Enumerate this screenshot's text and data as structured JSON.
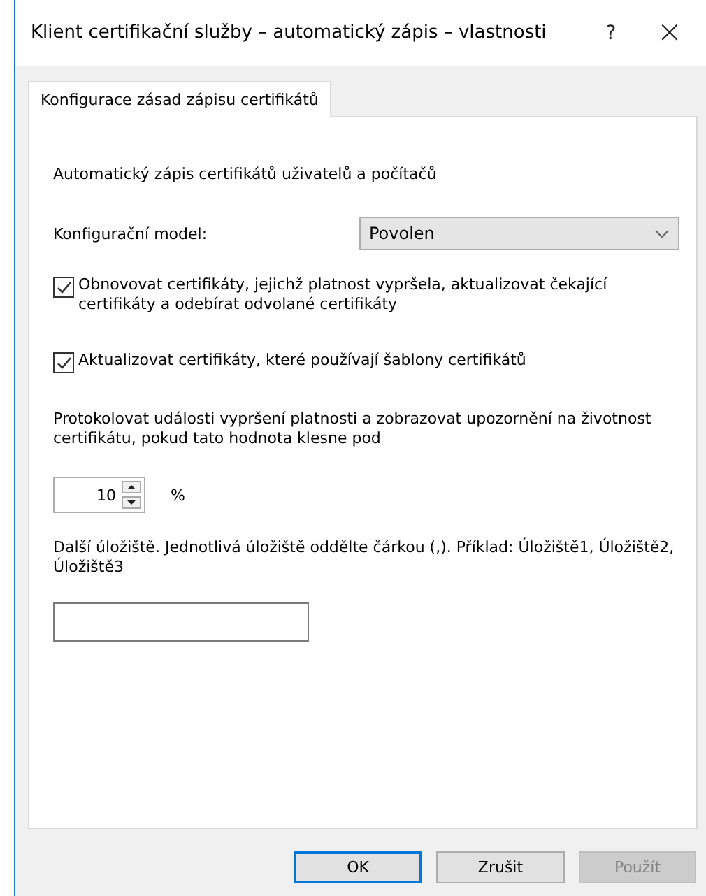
{
  "window": {
    "title": "Klient certifikační služby – automatický zápis – vlastnosti",
    "help": "?",
    "close": "×"
  },
  "tabs": [
    {
      "label": "Konfigurace zásad zápisu certifikátů",
      "selected": true
    }
  ],
  "heading": "Automatický zápis certifikátů uživatelů a počítačů",
  "config_model": {
    "label": "Konfigurační model:",
    "value": "Povolen"
  },
  "checkboxes": [
    {
      "label": "Obnovovat certifikáty, jejichž platnost vypršela, aktualizovat čekající certifikáty a odebírat odvolané certifikáty",
      "checked": true
    },
    {
      "label": "Aktualizovat certifikáty, které používají šablony certifikátů",
      "checked": true
    }
  ],
  "expiry": {
    "label": "Protokolovat události vypršení platnosti a zobrazovat upozornění na životnost certifikátu, pokud tato hodnota klesne pod",
    "value": "10",
    "unit": "%"
  },
  "stores": {
    "label": "Další úložiště. Jednotlivá úložiště oddělte čárkou (,). Příklad: Úložiště1, Úložiště2, Úložiště3"
  },
  "buttons": [
    {
      "label": "OK",
      "default": true,
      "disabled": false
    },
    {
      "label": "Zrušit",
      "default": false,
      "disabled": false
    },
    {
      "label": "Použít",
      "default": false,
      "disabled": true
    }
  ]
}
